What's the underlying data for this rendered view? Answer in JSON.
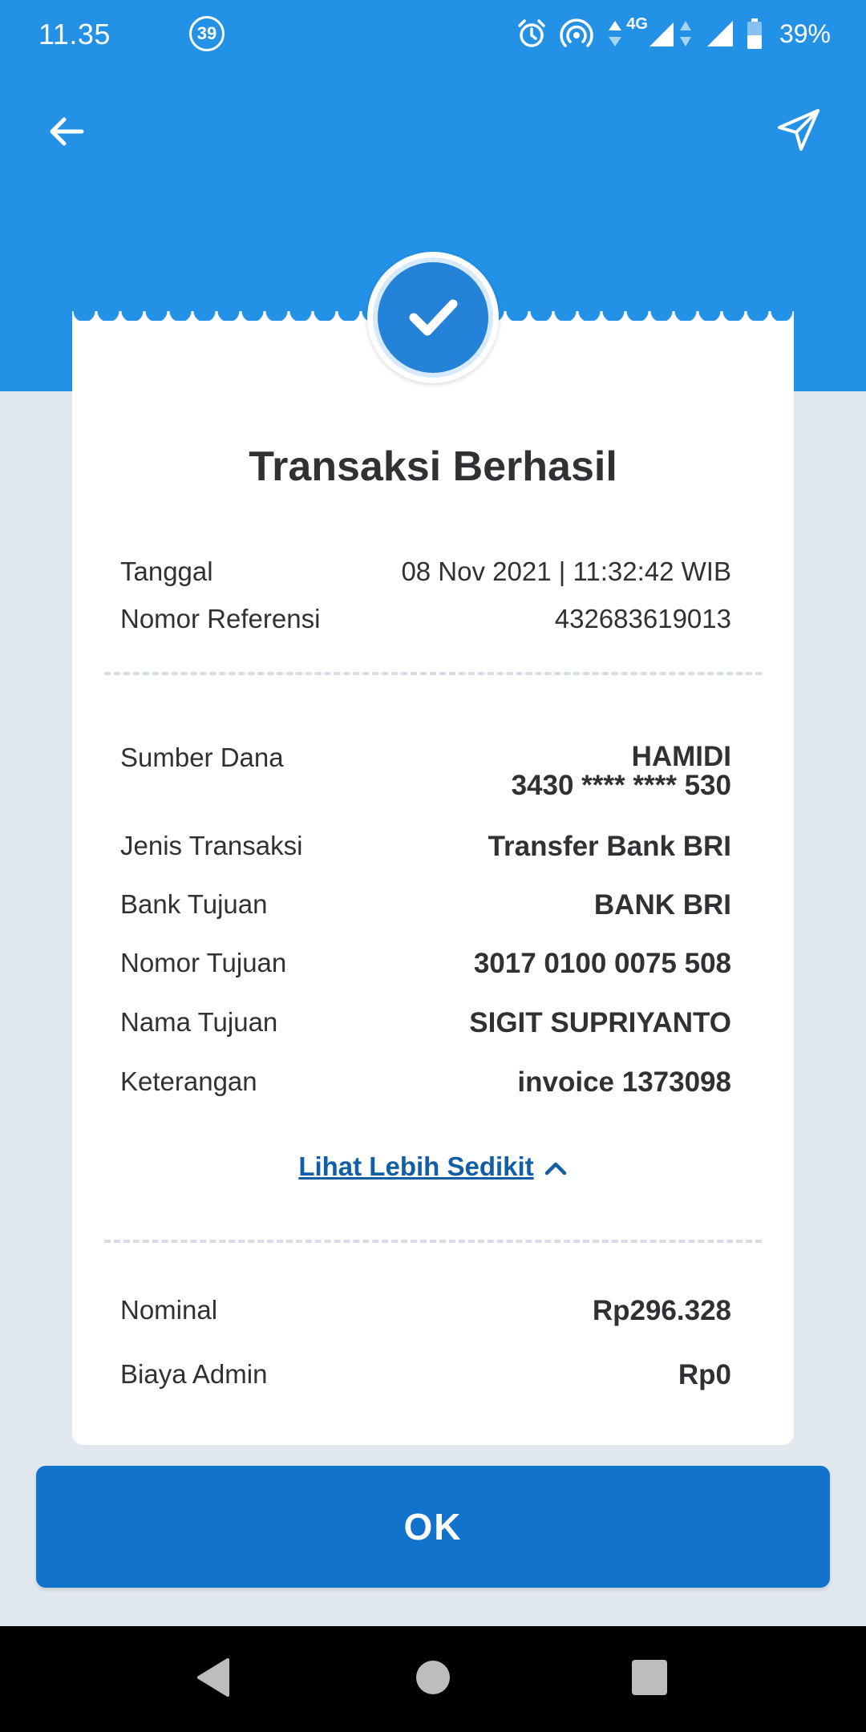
{
  "status_bar": {
    "time": "11.35",
    "notification_count": "39",
    "network": "4G",
    "battery": "39%"
  },
  "icons": {
    "back": "arrow-left-icon",
    "share": "send-icon",
    "success": "checkmark-icon",
    "toggle": "chevron-up-icon"
  },
  "colors": {
    "header": "#2391e5",
    "primary_button": "#1273cc",
    "link": "#125fa6",
    "background": "#e1e7ef"
  },
  "receipt": {
    "title": "Transaksi Berhasil",
    "date_label": "Tanggal",
    "date_value": "08 Nov 2021 | 11:32:42 WIB",
    "reference_label": "Nomor Referensi",
    "reference_value": "432683619013",
    "source_label": "Sumber Dana",
    "source_name": "HAMIDI",
    "source_account": "3430 **** **** 530",
    "type_label": "Jenis Transaksi",
    "type_value": "Transfer Bank BRI",
    "bank_label": "Bank Tujuan",
    "bank_value": "BANK BRI",
    "dest_number_label": "Nomor Tujuan",
    "dest_number_value": "3017 0100 0075 508",
    "dest_name_label": "Nama Tujuan",
    "dest_name_value": "SIGIT SUPRIYANTO",
    "note_label": "Keterangan",
    "note_value": "invoice 1373098",
    "toggle_link": "Lihat Lebih Sedikit",
    "amount_label": "Nominal",
    "amount_value": "Rp296.328",
    "fee_label": "Biaya Admin",
    "fee_value": "Rp0"
  },
  "actions": {
    "ok_label": "OK"
  }
}
